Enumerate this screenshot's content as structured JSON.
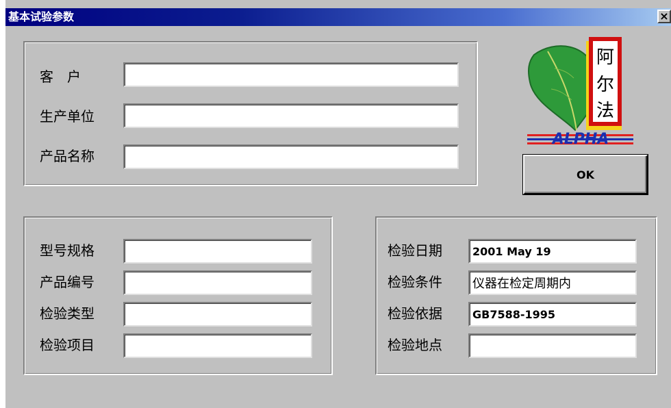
{
  "window": {
    "title": "基本试验参数",
    "close_glyph": "×"
  },
  "customer_group": {
    "fields": [
      {
        "label": "客　户",
        "value": ""
      },
      {
        "label": "生产单位",
        "value": ""
      },
      {
        "label": "产品名称",
        "value": ""
      }
    ]
  },
  "product_group": {
    "fields": [
      {
        "label": "型号规格",
        "value": ""
      },
      {
        "label": "产品编号",
        "value": ""
      },
      {
        "label": "检验类型",
        "value": ""
      },
      {
        "label": "检验项目",
        "value": ""
      }
    ]
  },
  "inspection_group": {
    "fields": [
      {
        "label": "检验日期",
        "value": "2001 May 19"
      },
      {
        "label": "检验条件",
        "value": "仪器在检定周期内"
      },
      {
        "label": "检验依据",
        "value": "GB7588-1995"
      },
      {
        "label": "检验地点",
        "value": ""
      }
    ]
  },
  "logo": {
    "icon": "leaf-logo-icon",
    "seal_chars": [
      "阿",
      "尔",
      "法"
    ],
    "brand": "ALPHA"
  },
  "ok_button": {
    "label": "OK"
  },
  "colors": {
    "face": "#c0c0c0",
    "titlebar_start": "#000080",
    "titlebar_end": "#a6caf0",
    "leaf_green": "#2e9a3a",
    "seal_red": "#d01010",
    "brand_blue": "#1a2fb0",
    "brand_red": "#e02020"
  }
}
